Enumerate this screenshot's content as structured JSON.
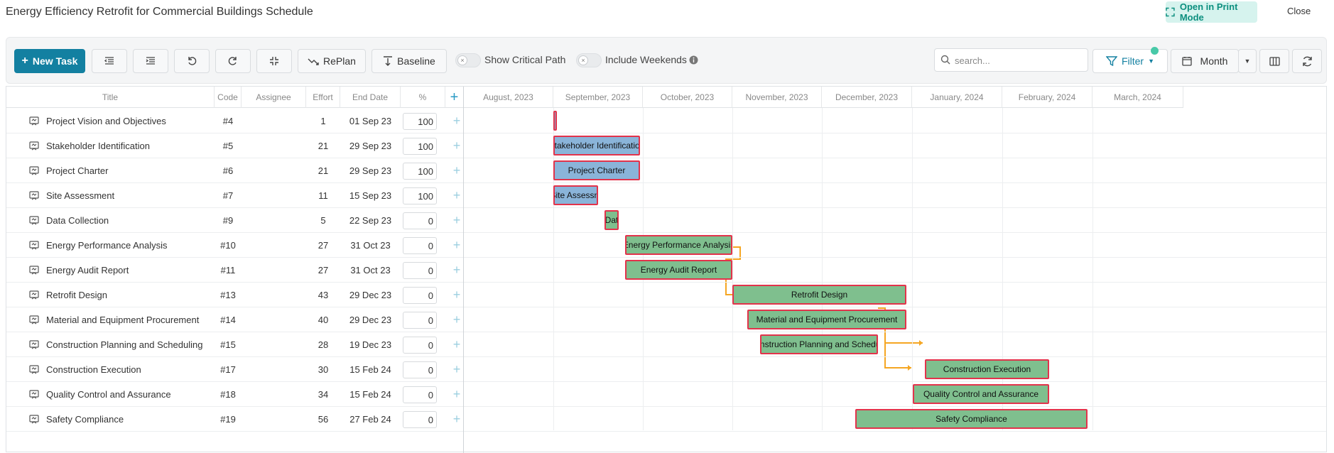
{
  "page": {
    "title": "Energy Efficiency Retrofit for Commercial Buildings Schedule",
    "print_label": "Open in Print Mode",
    "close_label": "Close"
  },
  "toolbar": {
    "new_task_label": "New Task",
    "replan_label": "RePlan",
    "baseline_label": "Baseline",
    "critical_path_label": "Show Critical Path",
    "weekends_label": "Include Weekends",
    "search_placeholder": "search...",
    "filter_label": "Filter",
    "scale_label": "Month"
  },
  "columns": {
    "title": "Title",
    "code": "Code",
    "assignee": "Assignee",
    "effort": "Effort",
    "end_date": "End Date",
    "percent": "%"
  },
  "months": [
    "August, 2023",
    "September, 2023",
    "October, 2023",
    "November, 2023",
    "December, 2023",
    "January, 2024",
    "February, 2024",
    "March, 2024"
  ],
  "tasks": [
    {
      "title": "Project Vision and Objectives",
      "code": "#4",
      "assignee": "",
      "effort": "1",
      "end_date": "01 Sep 23",
      "percent": "100",
      "bar_label": ""
    },
    {
      "title": "Stakeholder Identification",
      "code": "#5",
      "assignee": "",
      "effort": "21",
      "end_date": "29 Sep 23",
      "percent": "100",
      "bar_label": "Stakeholder Identification"
    },
    {
      "title": "Project Charter",
      "code": "#6",
      "assignee": "",
      "effort": "21",
      "end_date": "29 Sep 23",
      "percent": "100",
      "bar_label": "Project Charter"
    },
    {
      "title": "Site Assessment",
      "code": "#7",
      "assignee": "",
      "effort": "11",
      "end_date": "15 Sep 23",
      "percent": "100",
      "bar_label": "Site Assessm"
    },
    {
      "title": "Data Collection",
      "code": "#9",
      "assignee": "",
      "effort": "5",
      "end_date": "22 Sep 23",
      "percent": "0",
      "bar_label": "Dat"
    },
    {
      "title": "Energy Performance Analysis",
      "code": "#10",
      "assignee": "",
      "effort": "27",
      "end_date": "31 Oct 23",
      "percent": "0",
      "bar_label": "Energy Performance Analysis"
    },
    {
      "title": "Energy Audit Report",
      "code": "#11",
      "assignee": "",
      "effort": "27",
      "end_date": "31 Oct 23",
      "percent": "0",
      "bar_label": "Energy Audit Report"
    },
    {
      "title": "Retrofit Design",
      "code": "#13",
      "assignee": "",
      "effort": "43",
      "end_date": "29 Dec 23",
      "percent": "0",
      "bar_label": "Retrofit Design"
    },
    {
      "title": "Material and Equipment Procurement",
      "code": "#14",
      "assignee": "",
      "effort": "40",
      "end_date": "29 Dec 23",
      "percent": "0",
      "bar_label": "Material and Equipment Procurement"
    },
    {
      "title": "Construction Planning and Scheduling",
      "code": "#15",
      "assignee": "",
      "effort": "28",
      "end_date": "19 Dec 23",
      "percent": "0",
      "bar_label": "Construction Planning and Schedulin"
    },
    {
      "title": "Construction Execution",
      "code": "#17",
      "assignee": "",
      "effort": "30",
      "end_date": "15 Feb 24",
      "percent": "0",
      "bar_label": "Construction Execution"
    },
    {
      "title": "Quality Control and Assurance",
      "code": "#18",
      "assignee": "",
      "effort": "34",
      "end_date": "15 Feb 24",
      "percent": "0",
      "bar_label": "Quality Control and Assurance"
    },
    {
      "title": "Safety Compliance",
      "code": "#19",
      "assignee": "",
      "effort": "56",
      "end_date": "27 Feb 24",
      "percent": "0",
      "bar_label": "Safety Compliance"
    }
  ],
  "colors": {
    "primary": "#1380a1",
    "done_bar": "#8ab4d9",
    "todo_bar": "#7fbf8e",
    "critical_border": "#e2334b",
    "dependency": "#f5a623",
    "print_bg": "#d6f3ee"
  }
}
